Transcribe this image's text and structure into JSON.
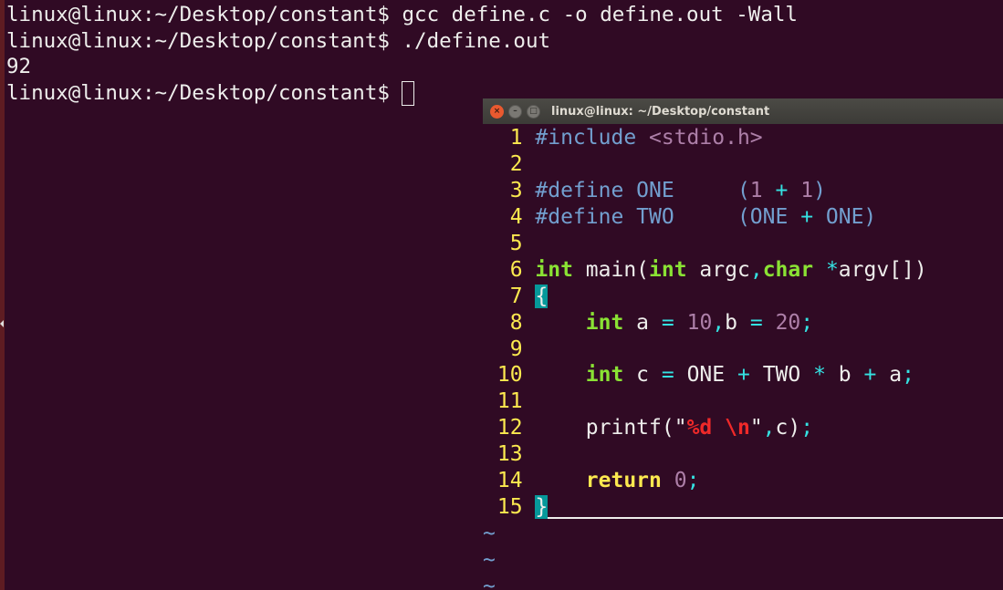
{
  "terminal": {
    "lines": [
      "linux@linux:~/Desktop/constant$ gcc define.c -o define.out -Wall",
      "linux@linux:~/Desktop/constant$ ./define.out",
      "92",
      "linux@linux:~/Desktop/constant$ "
    ]
  },
  "vim_window": {
    "title": "linux@linux: ~/Desktop/constant",
    "buttons": {
      "close": "×",
      "minimize": "–",
      "maximize": "□"
    },
    "tilde": "~",
    "code": [
      [
        [
          "#include ",
          "pre"
        ],
        [
          "<stdio.h>",
          "con"
        ]
      ],
      [],
      [
        [
          "#define ONE     (",
          "pre"
        ],
        [
          "1",
          "con"
        ],
        [
          " ",
          "nt"
        ],
        [
          "+",
          "op"
        ],
        [
          " ",
          "nt"
        ],
        [
          "1",
          "con"
        ],
        [
          ")",
          "pre"
        ]
      ],
      [
        [
          "#define TWO     (ONE ",
          "pre"
        ],
        [
          "+",
          "op"
        ],
        [
          " ONE)",
          "pre"
        ]
      ],
      [],
      [
        [
          "int",
          "typ"
        ],
        [
          " main(",
          "nt"
        ],
        [
          "int",
          "typ"
        ],
        [
          " argc",
          "nt"
        ],
        [
          ",",
          "op"
        ],
        [
          "char",
          "typ"
        ],
        [
          " ",
          "nt"
        ],
        [
          "*",
          "op"
        ],
        [
          "argv[])",
          "nt"
        ]
      ],
      [
        [
          "{",
          "mp"
        ]
      ],
      [
        [
          "    ",
          "nt"
        ],
        [
          "int",
          "typ"
        ],
        [
          " a ",
          "nt"
        ],
        [
          "=",
          "op"
        ],
        [
          " ",
          "nt"
        ],
        [
          "10",
          "con"
        ],
        [
          ",",
          "op"
        ],
        [
          "b ",
          "nt"
        ],
        [
          "=",
          "op"
        ],
        [
          " ",
          "nt"
        ],
        [
          "20",
          "con"
        ],
        [
          ";",
          "op"
        ]
      ],
      [],
      [
        [
          "    ",
          "nt"
        ],
        [
          "int",
          "typ"
        ],
        [
          " c ",
          "nt"
        ],
        [
          "=",
          "op"
        ],
        [
          " ONE ",
          "nt"
        ],
        [
          "+",
          "op"
        ],
        [
          " TWO ",
          "nt"
        ],
        [
          "*",
          "op"
        ],
        [
          " b ",
          "nt"
        ],
        [
          "+",
          "op"
        ],
        [
          " a",
          "nt"
        ],
        [
          ";",
          "op"
        ]
      ],
      [],
      [
        [
          "    printf(\"",
          "nt"
        ],
        [
          "%d \\n",
          "sp"
        ],
        [
          "\"",
          "nt"
        ],
        [
          ",",
          "op"
        ],
        [
          "c)",
          "nt"
        ],
        [
          ";",
          "op"
        ]
      ],
      [],
      [
        [
          "    ",
          "nt"
        ],
        [
          "return",
          "st"
        ],
        [
          " ",
          "nt"
        ],
        [
          "0",
          "con"
        ],
        [
          ";",
          "op"
        ]
      ],
      [
        [
          "}",
          "mp"
        ]
      ]
    ]
  }
}
